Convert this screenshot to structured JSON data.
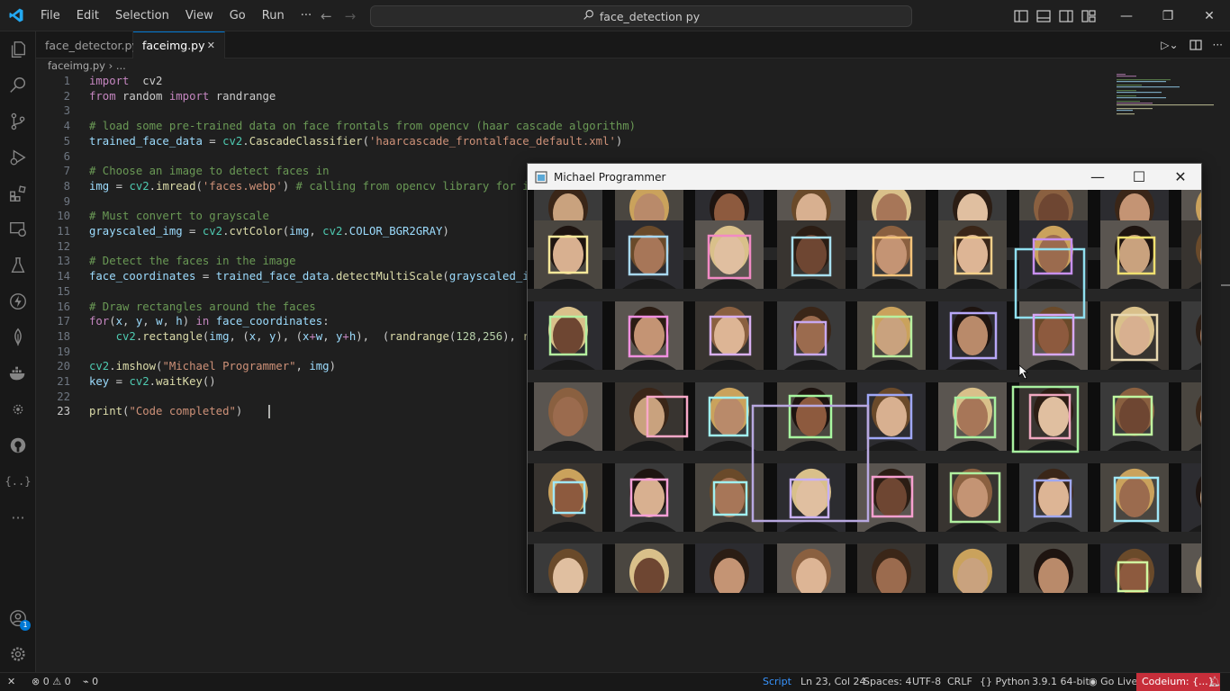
{
  "menu": {
    "file": "File",
    "edit": "Edit",
    "selection": "Selection",
    "view": "View",
    "go": "Go",
    "run": "Run",
    "more": "···"
  },
  "command_center": {
    "text": "face_detection py"
  },
  "tabs": [
    {
      "label": "face_detector.py"
    },
    {
      "label": "faceimg.py"
    }
  ],
  "breadcrumb": {
    "file": "faceimg.py",
    "sep": "›",
    "rest": "..."
  },
  "editor": {
    "lines": [
      {
        "num": "1",
        "tokens": [
          [
            "kw",
            "import"
          ],
          [
            "",
            "  "
          ],
          [
            "",
            "cv2"
          ]
        ]
      },
      {
        "num": "2",
        "tokens": [
          [
            "kw",
            "from"
          ],
          [
            "",
            " "
          ],
          [
            "",
            "random"
          ],
          [
            "",
            " "
          ],
          [
            "kw",
            "import"
          ],
          [
            "",
            " "
          ],
          [
            "",
            "randrange"
          ]
        ]
      },
      {
        "num": "3",
        "tokens": []
      },
      {
        "num": "4",
        "tokens": [
          [
            "cm",
            "# load some pre-trained data on face frontals from opencv (haar cascade algorithm)"
          ]
        ]
      },
      {
        "num": "5",
        "tokens": [
          [
            "vr",
            "trained_face_data"
          ],
          [
            "",
            " = "
          ],
          [
            "cl",
            "cv2"
          ],
          [
            "",
            "."
          ],
          [
            "mth",
            "CascadeClassifier"
          ],
          [
            "",
            "("
          ],
          [
            "st",
            "'haarcascade_frontalface_default.xml'"
          ],
          [
            "",
            ")"
          ]
        ]
      },
      {
        "num": "6",
        "tokens": []
      },
      {
        "num": "7",
        "tokens": [
          [
            "cm",
            "# Choose an image to detect faces in"
          ]
        ]
      },
      {
        "num": "8",
        "tokens": [
          [
            "vr",
            "img"
          ],
          [
            "",
            " = "
          ],
          [
            "cl",
            "cv2"
          ],
          [
            "",
            "."
          ],
          [
            "mth",
            "imread"
          ],
          [
            "",
            "("
          ],
          [
            "st",
            "'faces.webp'"
          ],
          [
            "",
            ") "
          ],
          [
            "cm",
            "# calling from opencv library for image"
          ]
        ]
      },
      {
        "num": "9",
        "tokens": []
      },
      {
        "num": "10",
        "tokens": [
          [
            "cm",
            "# Must convert to grayscale"
          ]
        ]
      },
      {
        "num": "11",
        "tokens": [
          [
            "vr",
            "grayscaled_img"
          ],
          [
            "",
            " = "
          ],
          [
            "cl",
            "cv2"
          ],
          [
            "",
            "."
          ],
          [
            "mth",
            "cvtColor"
          ],
          [
            "",
            "("
          ],
          [
            "vr",
            "img"
          ],
          [
            "",
            ", "
          ],
          [
            "cl",
            "cv2"
          ],
          [
            "",
            "."
          ],
          [
            "vr",
            "COLOR_BGR2GRAY"
          ],
          [
            "",
            ")"
          ]
        ]
      },
      {
        "num": "12",
        "tokens": []
      },
      {
        "num": "13",
        "tokens": [
          [
            "cm",
            "# Detect the faces in the image"
          ]
        ]
      },
      {
        "num": "14",
        "tokens": [
          [
            "vr",
            "face_coordinates"
          ],
          [
            "",
            " = "
          ],
          [
            "vr",
            "trained_face_data"
          ],
          [
            "",
            "."
          ],
          [
            "mth",
            "detectMultiScale"
          ],
          [
            "",
            "("
          ],
          [
            "vr",
            "grayscaled_img"
          ],
          [
            "",
            ")"
          ]
        ]
      },
      {
        "num": "15",
        "tokens": []
      },
      {
        "num": "16",
        "tokens": [
          [
            "cm",
            "# Draw rectangles around the faces"
          ]
        ]
      },
      {
        "num": "17",
        "tokens": [
          [
            "kw",
            "for"
          ],
          [
            "",
            "("
          ],
          [
            "vr",
            "x"
          ],
          [
            "",
            ", "
          ],
          [
            "vr",
            "y"
          ],
          [
            "",
            ", "
          ],
          [
            "vr",
            "w"
          ],
          [
            "",
            ", "
          ],
          [
            "vr",
            "h"
          ],
          [
            "",
            ") "
          ],
          [
            "kw",
            "in"
          ],
          [
            "",
            " "
          ],
          [
            "vr",
            "face_coordinates"
          ],
          [
            "",
            ":"
          ]
        ]
      },
      {
        "num": "18",
        "tokens": [
          [
            "",
            "    "
          ],
          [
            "cl",
            "cv2"
          ],
          [
            "",
            "."
          ],
          [
            "mth",
            "rectangle"
          ],
          [
            "",
            "("
          ],
          [
            "vr",
            "img"
          ],
          [
            "",
            ", ("
          ],
          [
            "vr",
            "x"
          ],
          [
            "",
            ", "
          ],
          [
            "vr",
            "y"
          ],
          [
            "",
            "), ("
          ],
          [
            "vr",
            "x"
          ],
          [
            "kw",
            "+"
          ],
          [
            "vr",
            "w"
          ],
          [
            "",
            ", "
          ],
          [
            "vr",
            "y"
          ],
          [
            "kw",
            "+"
          ],
          [
            "vr",
            "h"
          ],
          [
            "",
            "),  ("
          ],
          [
            "mth",
            "randrange"
          ],
          [
            "",
            "("
          ],
          [
            "nm",
            "128"
          ],
          [
            "",
            ","
          ],
          [
            "nm",
            "256"
          ],
          [
            "",
            "), "
          ],
          [
            "mth",
            "randra"
          ]
        ]
      },
      {
        "num": "19",
        "tokens": []
      },
      {
        "num": "20",
        "tokens": [
          [
            "cl",
            "cv2"
          ],
          [
            "",
            "."
          ],
          [
            "mth",
            "imshow"
          ],
          [
            "",
            "("
          ],
          [
            "st",
            "\"Michael Programmer\""
          ],
          [
            "",
            ", "
          ],
          [
            "vr",
            "img"
          ],
          [
            "",
            ")"
          ]
        ]
      },
      {
        "num": "21",
        "tokens": [
          [
            "vr",
            "key"
          ],
          [
            "",
            " = "
          ],
          [
            "cl",
            "cv2"
          ],
          [
            "",
            "."
          ],
          [
            "mth",
            "waitKey"
          ],
          [
            "",
            "()"
          ]
        ]
      },
      {
        "num": "22",
        "tokens": []
      },
      {
        "num": "23",
        "tokens": [
          [
            "fn",
            "print"
          ],
          [
            "",
            "("
          ],
          [
            "st",
            "\"Code completed\""
          ],
          [
            "",
            ")"
          ]
        ]
      }
    ],
    "current_line": "23"
  },
  "image_window": {
    "title": "Michael Programmer",
    "minimize": "—",
    "maximize": "☐",
    "close": "✕"
  },
  "status": {
    "remote": "⚡",
    "errors": "0",
    "warnings": "0",
    "ports": "0",
    "script": "Script",
    "position": "Ln 23, Col 24",
    "spaces": "Spaces: 4",
    "encoding": "UTF-8",
    "eol": "CRLF",
    "language": "Python",
    "interpreter": "3.9.1 64-bit",
    "golive": "Go Live",
    "codeium": "Codeium: {...}",
    "accounts_badge": "1"
  },
  "colors": {
    "accent": "#0078d4",
    "codeium_bg": "#c72e3a",
    "python_yellow": "#ffd43b"
  }
}
